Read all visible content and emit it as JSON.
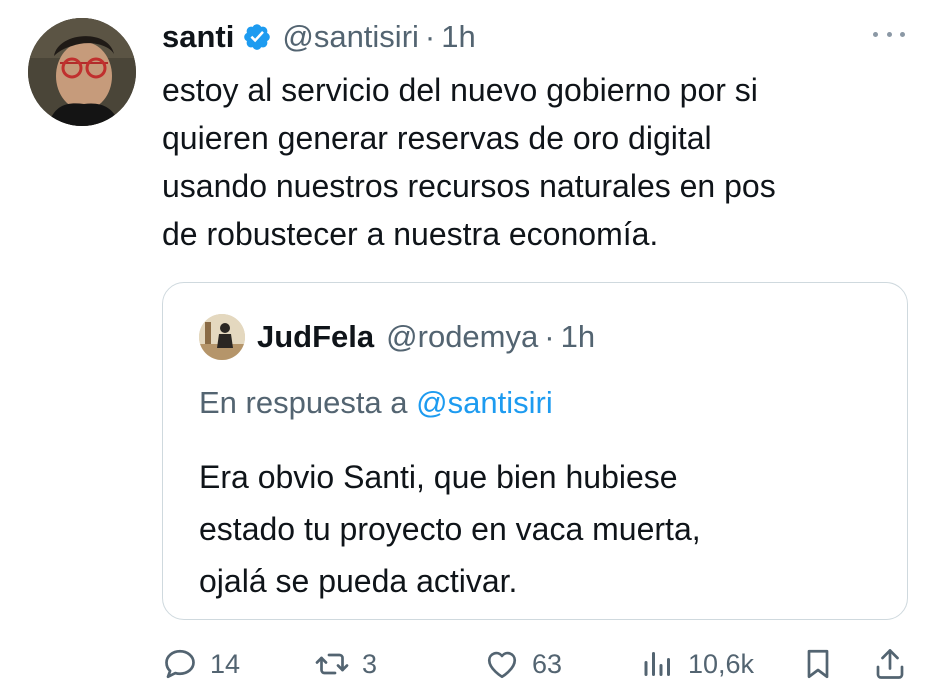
{
  "tweet": {
    "author": {
      "name": "santi",
      "handle": "@santisiri",
      "time": "1h",
      "separator": "·"
    },
    "text_lines": [
      "estoy al servicio del nuevo gobierno por si",
      "quieren generar reservas de oro digital",
      "usando nuestros recursos naturales en pos",
      "de robustecer a nuestra economía."
    ],
    "quote": {
      "author": {
        "name": "JudFela",
        "handle": "@rodemya",
        "time": "1h",
        "separator": "·"
      },
      "reply_prefix": "En respuesta a",
      "reply_mention": "@santisiri",
      "text_lines": [
        "Era obvio Santi, que bien hubiese",
        "estado tu proyecto en vaca muerta,",
        "ojalá se pueda activar."
      ]
    },
    "actions": {
      "replies": "14",
      "reposts": "3",
      "likes": "63",
      "views": "10,6k"
    }
  },
  "colors": {
    "text": "#0f1419",
    "secondary": "#536471",
    "accent": "#1d9bf0",
    "border": "#cfd9de"
  },
  "icons": [
    "verified-badge-icon",
    "more-icon",
    "reply-icon",
    "repost-icon",
    "like-icon",
    "views-icon",
    "bookmark-icon",
    "share-icon"
  ]
}
